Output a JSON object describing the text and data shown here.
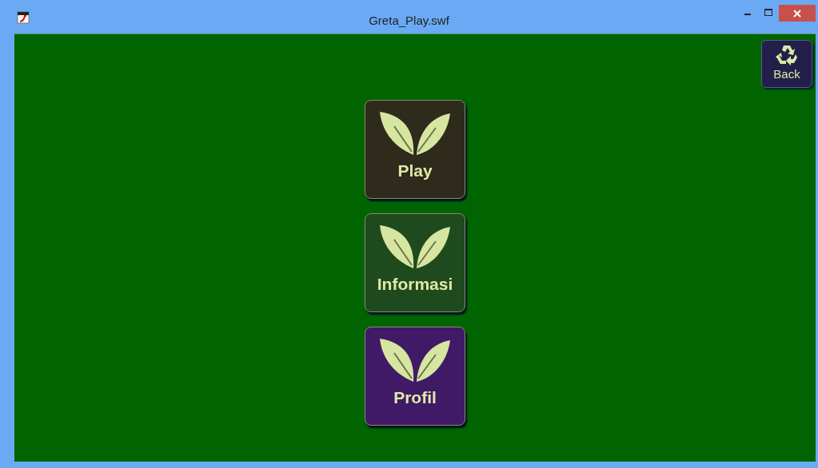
{
  "window": {
    "title": "Greta_Play.swf"
  },
  "back_button": {
    "label": "Back"
  },
  "menu_buttons": [
    {
      "label": "Play",
      "color": "#2e2a1c"
    },
    {
      "label": "Informasi",
      "color": "#1f4a1d"
    },
    {
      "label": "Profil",
      "color": "#401a66"
    }
  ]
}
